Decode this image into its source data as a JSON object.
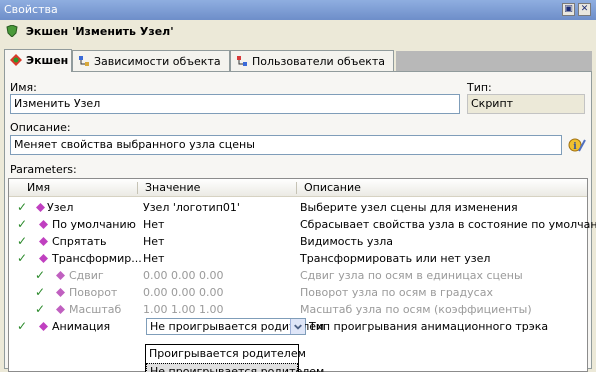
{
  "window": {
    "title": "Свойства"
  },
  "header": {
    "title": "Экшен 'Изменить Узел'"
  },
  "tabs": [
    {
      "label": "Экшен"
    },
    {
      "label": "Зависимости объекта"
    },
    {
      "label": "Пользователи объекта"
    }
  ],
  "form": {
    "name_label": "Имя:",
    "name_value": "Изменить Узел",
    "type_label": "Тип:",
    "type_value": "Скрипт",
    "desc_label": "Описание:",
    "desc_value": "Меняет свойства выбранного узла сцены"
  },
  "parameters": {
    "label": "Parameters:",
    "columns": {
      "name": "Имя",
      "value": "Значение",
      "description": "Описание"
    },
    "rows": [
      {
        "name": "Узел",
        "value": "Узел 'логотип01'",
        "description": "Выберите узел сцены для изменения"
      },
      {
        "name": "По умолчанию",
        "value": "Нет",
        "description": "Сбрасывает свойства узла в состояние по умолчанию"
      },
      {
        "name": "Спрятать",
        "value": "Нет",
        "description": "Видимость узла"
      },
      {
        "name": "Трансформир...",
        "value": "Нет",
        "description": "Трансформировать или нет узел"
      },
      {
        "name": "Сдвиг",
        "value": "0.00  0.00  0.00",
        "description": "Сдвиг узла по осям в единицах сцены"
      },
      {
        "name": "Поворот",
        "value": "0.00  0.00  0.00",
        "description": "Поворот узла по осям в градусах"
      },
      {
        "name": "Масштаб",
        "value": "1.00  1.00  1.00",
        "description": "Масштаб узла по осям (коэффициенты)"
      },
      {
        "name": "Анимация",
        "value": "Не проигрывается родителем",
        "description": "Тип проигрывания анимационного трэка"
      }
    ]
  },
  "dropdown": {
    "options": [
      "Проигрывается родителем",
      "Не проигрывается родителем"
    ]
  },
  "colors": {
    "check": "#2c8a2c",
    "gem": "#c040c0",
    "titlebar": "#7a9ad4"
  }
}
